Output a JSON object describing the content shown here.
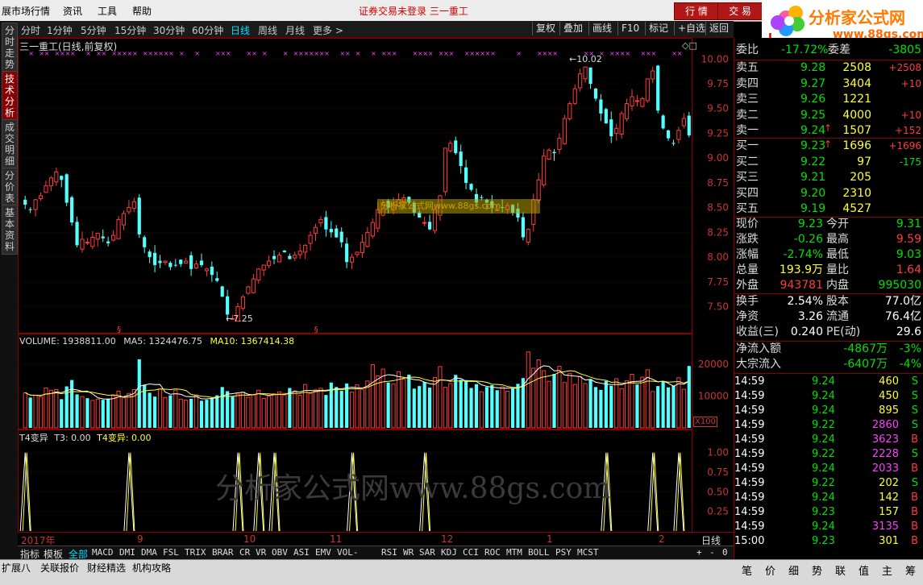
{
  "menu": {
    "app_title": "展市场行情",
    "items": [
      "资讯",
      "工具",
      "帮助"
    ],
    "center": "证券交易未登录  三一重工",
    "btn_quote": "行 情",
    "btn_trade": "交 易"
  },
  "logo": {
    "brand": "分析家公式网",
    "url": "www.88gs.com",
    "mark": "L"
  },
  "left_tabs": [
    "分时走势",
    "技术分析",
    "成交明细",
    "分价表",
    "基本资料"
  ],
  "toolbar": {
    "periods": [
      "分时",
      "1分钟",
      "5分钟",
      "15分钟",
      "30分钟",
      "60分钟",
      "日线",
      "周线",
      "月线",
      "更多 >"
    ],
    "selected": "日线",
    "right": [
      "复权",
      "叠加",
      "画线",
      "F10",
      "标记",
      "+自选",
      "返回"
    ]
  },
  "main_chart": {
    "title": "三一重工(日线,前复权)",
    "high_label": "10.02",
    "low_label": "7.25",
    "watermark": "分析家公式网www.88gs.com",
    "y_ticks": [
      "10.00",
      "9.75",
      "9.50",
      "9.25",
      "9.00",
      "8.75",
      "8.50",
      "8.25",
      "8.00",
      "7.75",
      "7.50"
    ]
  },
  "volume_chart": {
    "label_volume": "VOLUME: 1938811.00",
    "label_ma5": "MA5: 1324476.75",
    "label_ma10": "MA10: 1367414.38",
    "y_ticks": [
      "20000",
      "10000"
    ],
    "unit": "X100"
  },
  "indicator_chart": {
    "label_name": "T4变异",
    "label_t3": "T3: 0.00",
    "label_t4": "T4变异: 0.00",
    "y_ticks": [
      "1.00",
      "0.75",
      "0.50",
      "0.25"
    ],
    "watermark": "分析家公式网www.88gs.com"
  },
  "x_axis": {
    "labels": [
      "2017年",
      "9",
      "10",
      "11",
      "12",
      "1",
      "2"
    ],
    "period_btn": "日线"
  },
  "indicators": {
    "tabs": [
      "指标",
      "模板",
      "全部"
    ],
    "list": [
      "MACD",
      "DMI",
      "DMA",
      "FSL",
      "TRIX",
      "BRAR",
      "CR",
      "VR",
      "OBV",
      "ASI",
      "EMV",
      "VOL-TDX",
      "RSI",
      "WR",
      "SAR",
      "KDJ",
      "CCI",
      "ROC",
      "MTM",
      "BOLL",
      "PSY",
      "MCST"
    ],
    "controls": [
      "+",
      "-",
      "0"
    ]
  },
  "bottom_tabs": [
    "扩展八",
    "关联报价",
    "财经精选",
    "机构攻略"
  ],
  "right_tabs": [
    "笔",
    "价",
    "细",
    "势",
    "联",
    "值",
    "主",
    "筹"
  ],
  "quote": {
    "weibi_label": "委比",
    "weibi": "-17.72%",
    "weicha_label": "委差",
    "weicha": "-3805",
    "asks": [
      {
        "label": "卖五",
        "price": "9.28",
        "vol": "2508",
        "chg": "+2508"
      },
      {
        "label": "卖四",
        "price": "9.27",
        "vol": "3404",
        "chg": "+10"
      },
      {
        "label": "卖三",
        "price": "9.26",
        "vol": "1221",
        "chg": ""
      },
      {
        "label": "卖二",
        "price": "9.25",
        "vol": "4000",
        "chg": "+10"
      },
      {
        "label": "卖一",
        "price": "9.24",
        "vol": "1507",
        "chg": "+152"
      }
    ],
    "bids": [
      {
        "label": "买一",
        "price": "9.23",
        "vol": "1696",
        "chg": "+1696"
      },
      {
        "label": "买二",
        "price": "9.22",
        "vol": "97",
        "chg": "-175"
      },
      {
        "label": "买三",
        "price": "9.21",
        "vol": "205",
        "chg": ""
      },
      {
        "label": "买四",
        "price": "9.20",
        "vol": "2310",
        "chg": ""
      },
      {
        "label": "买五",
        "price": "9.19",
        "vol": "4527",
        "chg": ""
      }
    ],
    "stats": [
      {
        "l1": "现价",
        "v1": "9.23",
        "l2": "今开",
        "v2": "9.31"
      },
      {
        "l1": "涨跌",
        "v1": "-0.26",
        "l2": "最高",
        "v2": "9.59"
      },
      {
        "l1": "涨幅",
        "v1": "-2.74%",
        "l2": "最低",
        "v2": "9.03"
      },
      {
        "l1": "总量",
        "v1": "193.9万",
        "l2": "量比",
        "v2": "1.64"
      },
      {
        "l1": "外盘",
        "v1": "943781",
        "l2": "内盘",
        "v2": "995030"
      }
    ],
    "stats2": [
      {
        "l1": "换手",
        "v1": "2.54%",
        "l2": "股本",
        "v2": "77.0亿"
      },
      {
        "l1": "净资",
        "v1": "3.26",
        "l2": "流通",
        "v2": "76.4亿"
      },
      {
        "l1": "收益(三)",
        "v1": "0.240",
        "l2": "PE(动)",
        "v2": "29.6"
      }
    ],
    "flow": [
      {
        "label": "净流入额",
        "value": "-4867万",
        "pct": "-3%"
      },
      {
        "label": "大宗流入",
        "value": "-6407万",
        "pct": "-4%"
      }
    ],
    "ticks": [
      {
        "time": "14:59",
        "price": "9.24",
        "vol": "460",
        "side": "S"
      },
      {
        "time": "14:59",
        "price": "9.24",
        "vol": "450",
        "side": "S"
      },
      {
        "time": "14:59",
        "price": "9.24",
        "vol": "895",
        "side": "S"
      },
      {
        "time": "14:59",
        "price": "9.22",
        "vol": "2860",
        "side": "S"
      },
      {
        "time": "14:59",
        "price": "9.24",
        "vol": "3623",
        "side": "B"
      },
      {
        "time": "14:59",
        "price": "9.22",
        "vol": "2228",
        "side": "S"
      },
      {
        "time": "14:59",
        "price": "9.24",
        "vol": "2033",
        "side": "B"
      },
      {
        "time": "14:59",
        "price": "9.22",
        "vol": "202",
        "side": "S"
      },
      {
        "time": "14:59",
        "price": "9.24",
        "vol": "142",
        "side": "B"
      },
      {
        "time": "14:59",
        "price": "9.23",
        "vol": "157",
        "side": "B"
      },
      {
        "time": "14:59",
        "price": "9.24",
        "vol": "3135",
        "side": "B"
      },
      {
        "time": "15:00",
        "price": "9.23",
        "vol": "301",
        "side": "B"
      }
    ]
  },
  "chart_data": {
    "type": "candlestick",
    "ylim": [
      7.35,
      10.1
    ],
    "closes": [
      8.53,
      8.48,
      8.58,
      8.62,
      8.72,
      8.8,
      8.86,
      8.78,
      8.55,
      8.35,
      8.12,
      8.18,
      8.15,
      8.2,
      8.24,
      8.19,
      8.14,
      8.22,
      8.38,
      8.44,
      8.5,
      8.56,
      8.23,
      8.1,
      8.0,
      7.92,
      7.94,
      7.96,
      7.9,
      7.92,
      7.93,
      7.96,
      7.88,
      7.93,
      7.92,
      7.88,
      7.82,
      7.76,
      7.6,
      7.42,
      7.38,
      7.5,
      7.6,
      7.7,
      7.78,
      7.88,
      7.92,
      7.96,
      7.98,
      8.02,
      8.05,
      7.98,
      8.02,
      8.06,
      8.12,
      8.22,
      8.3,
      8.38,
      8.28,
      8.25,
      8.2,
      8.15,
      7.95,
      8.0,
      8.05,
      8.15,
      8.25,
      8.35,
      8.48,
      8.55,
      8.5,
      8.53,
      8.58,
      8.6,
      8.55,
      8.45,
      8.4,
      8.35,
      8.28,
      8.48,
      8.62,
      9.1,
      9.15,
      9.05,
      8.92,
      8.75,
      8.68,
      8.55,
      8.6,
      8.55,
      8.5,
      8.48,
      8.5,
      8.52,
      8.45,
      8.4,
      8.2,
      8.28,
      8.58,
      8.78,
      9.02,
      9.08,
      9.05,
      9.2,
      9.4,
      9.55,
      9.7,
      9.85,
      9.92,
      9.75,
      9.6,
      9.45,
      9.35,
      9.22,
      9.3,
      9.45,
      9.55,
      9.62,
      9.58,
      9.6,
      9.8,
      9.88,
      9.48,
      9.3,
      9.2,
      9.15,
      9.28,
      9.4,
      9.23
    ],
    "volume": [
      11000,
      9500,
      10200,
      9800,
      12500,
      11800,
      12000,
      9000,
      13000,
      15000,
      10500,
      9800,
      9300,
      8600,
      9000,
      8800,
      9200,
      10100,
      11500,
      9400,
      10800,
      12000,
      21500,
      13500,
      11000,
      9800,
      12200,
      9500,
      10200,
      11800,
      9000,
      8700,
      9100,
      10300,
      8500,
      8800,
      9400,
      10200,
      12800,
      11500,
      9800,
      10600,
      11200,
      9600,
      10400,
      11800,
      9200,
      9900,
      10700,
      11300,
      10800,
      12500,
      11600,
      10200,
      13600,
      10800,
      11900,
      12400,
      10300,
      14200,
      12800,
      11600,
      13900,
      11200,
      13500,
      12100,
      14700,
      19800,
      16300,
      18400,
      14200,
      13800,
      17600,
      15200,
      16700,
      12300,
      13100,
      14400,
      12600,
      15800,
      19200,
      12700,
      13900,
      16600,
      15100,
      14800,
      12500,
      13700,
      11300,
      12800,
      13400,
      11800,
      12900,
      11500,
      12400,
      13800,
      15600,
      23800,
      18700,
      21300,
      17900,
      14600,
      16900,
      19300,
      14200,
      17100,
      13600,
      16100,
      13900,
      15300,
      12800,
      11900,
      14700,
      13200,
      15400,
      12300,
      14800,
      16800,
      13600,
      15900,
      18200,
      11400,
      13100,
      14600,
      12700,
      13300,
      15700,
      12100,
      19400
    ]
  }
}
